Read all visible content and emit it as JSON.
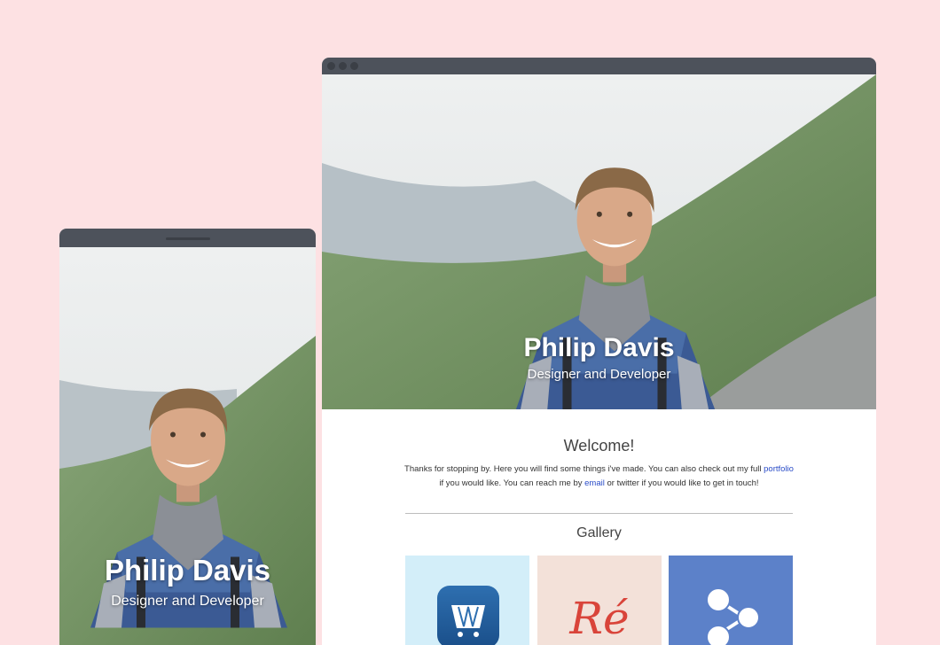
{
  "profile": {
    "name": "Philip Davis",
    "role": "Designer and Developer"
  },
  "welcome": {
    "title": "Welcome!",
    "text_1": "Thanks for stopping by. Here you will find some things i've made. You can also check out my full ",
    "portfolio_link": "portfolio",
    "text_2": " if you would like. You can reach me by ",
    "email_link": "email",
    "text_3": " or twitter if you would like to get in touch!"
  },
  "gallery": {
    "title": "Gallery",
    "items": [
      {
        "name": "shopping-cart-app",
        "icon": "cart-icon",
        "background": "#d3eef9"
      },
      {
        "name": "re-lettering",
        "text": "Ré",
        "background": "#f3e1d9"
      },
      {
        "name": "share-nodes",
        "icon": "share-icon",
        "background": "#5c81c9"
      }
    ]
  },
  "colors": {
    "page_background": "#fde1e3",
    "frame_bar": "#4d525b",
    "link": "#2a4cc7"
  }
}
